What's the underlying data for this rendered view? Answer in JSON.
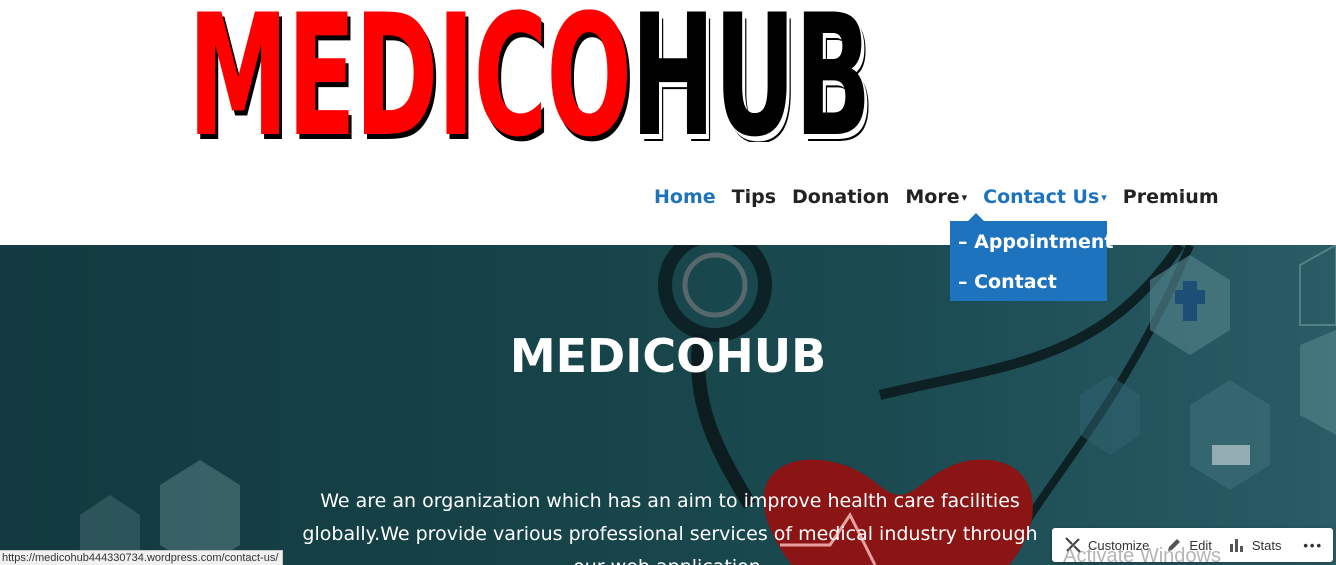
{
  "logo": {
    "part1": "MEDICO",
    "part2": "HUB"
  },
  "nav": {
    "items": [
      {
        "label": "Home",
        "active": true
      },
      {
        "label": "Tips"
      },
      {
        "label": "Donation"
      },
      {
        "label": "More",
        "caret": "▾"
      },
      {
        "label": "Contact Us",
        "caret": "▾",
        "active": true
      },
      {
        "label": "Premium"
      }
    ],
    "dropdown": [
      "– Appointment",
      "– Contact"
    ]
  },
  "hero": {
    "title": "MEDICOHUB",
    "text": "We are an organization which has an aim to improve health care facilities globally.We provide various professional services of medical industry through our web application."
  },
  "status_url": "https://medicohub444330734.wordpress.com/contact-us/",
  "admin_bar": {
    "customize": "Customize",
    "edit": "Edit",
    "stats": "Stats",
    "more": "•••"
  },
  "watermark": "Activate Windows",
  "colors": {
    "accent": "#1e73be",
    "logo_red": "#ff0000",
    "hero_bg": "#164348"
  }
}
